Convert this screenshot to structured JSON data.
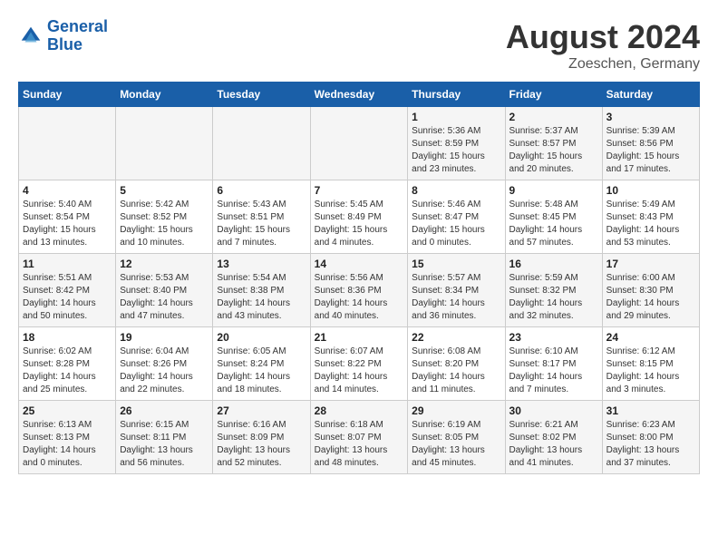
{
  "header": {
    "logo_line1": "General",
    "logo_line2": "Blue",
    "month": "August 2024",
    "location": "Zoeschen, Germany"
  },
  "weekdays": [
    "Sunday",
    "Monday",
    "Tuesday",
    "Wednesday",
    "Thursday",
    "Friday",
    "Saturday"
  ],
  "weeks": [
    [
      {
        "day": "",
        "info": ""
      },
      {
        "day": "",
        "info": ""
      },
      {
        "day": "",
        "info": ""
      },
      {
        "day": "",
        "info": ""
      },
      {
        "day": "1",
        "info": "Sunrise: 5:36 AM\nSunset: 8:59 PM\nDaylight: 15 hours\nand 23 minutes."
      },
      {
        "day": "2",
        "info": "Sunrise: 5:37 AM\nSunset: 8:57 PM\nDaylight: 15 hours\nand 20 minutes."
      },
      {
        "day": "3",
        "info": "Sunrise: 5:39 AM\nSunset: 8:56 PM\nDaylight: 15 hours\nand 17 minutes."
      }
    ],
    [
      {
        "day": "4",
        "info": "Sunrise: 5:40 AM\nSunset: 8:54 PM\nDaylight: 15 hours\nand 13 minutes."
      },
      {
        "day": "5",
        "info": "Sunrise: 5:42 AM\nSunset: 8:52 PM\nDaylight: 15 hours\nand 10 minutes."
      },
      {
        "day": "6",
        "info": "Sunrise: 5:43 AM\nSunset: 8:51 PM\nDaylight: 15 hours\nand 7 minutes."
      },
      {
        "day": "7",
        "info": "Sunrise: 5:45 AM\nSunset: 8:49 PM\nDaylight: 15 hours\nand 4 minutes."
      },
      {
        "day": "8",
        "info": "Sunrise: 5:46 AM\nSunset: 8:47 PM\nDaylight: 15 hours\nand 0 minutes."
      },
      {
        "day": "9",
        "info": "Sunrise: 5:48 AM\nSunset: 8:45 PM\nDaylight: 14 hours\nand 57 minutes."
      },
      {
        "day": "10",
        "info": "Sunrise: 5:49 AM\nSunset: 8:43 PM\nDaylight: 14 hours\nand 53 minutes."
      }
    ],
    [
      {
        "day": "11",
        "info": "Sunrise: 5:51 AM\nSunset: 8:42 PM\nDaylight: 14 hours\nand 50 minutes."
      },
      {
        "day": "12",
        "info": "Sunrise: 5:53 AM\nSunset: 8:40 PM\nDaylight: 14 hours\nand 47 minutes."
      },
      {
        "day": "13",
        "info": "Sunrise: 5:54 AM\nSunset: 8:38 PM\nDaylight: 14 hours\nand 43 minutes."
      },
      {
        "day": "14",
        "info": "Sunrise: 5:56 AM\nSunset: 8:36 PM\nDaylight: 14 hours\nand 40 minutes."
      },
      {
        "day": "15",
        "info": "Sunrise: 5:57 AM\nSunset: 8:34 PM\nDaylight: 14 hours\nand 36 minutes."
      },
      {
        "day": "16",
        "info": "Sunrise: 5:59 AM\nSunset: 8:32 PM\nDaylight: 14 hours\nand 32 minutes."
      },
      {
        "day": "17",
        "info": "Sunrise: 6:00 AM\nSunset: 8:30 PM\nDaylight: 14 hours\nand 29 minutes."
      }
    ],
    [
      {
        "day": "18",
        "info": "Sunrise: 6:02 AM\nSunset: 8:28 PM\nDaylight: 14 hours\nand 25 minutes."
      },
      {
        "day": "19",
        "info": "Sunrise: 6:04 AM\nSunset: 8:26 PM\nDaylight: 14 hours\nand 22 minutes."
      },
      {
        "day": "20",
        "info": "Sunrise: 6:05 AM\nSunset: 8:24 PM\nDaylight: 14 hours\nand 18 minutes."
      },
      {
        "day": "21",
        "info": "Sunrise: 6:07 AM\nSunset: 8:22 PM\nDaylight: 14 hours\nand 14 minutes."
      },
      {
        "day": "22",
        "info": "Sunrise: 6:08 AM\nSunset: 8:20 PM\nDaylight: 14 hours\nand 11 minutes."
      },
      {
        "day": "23",
        "info": "Sunrise: 6:10 AM\nSunset: 8:17 PM\nDaylight: 14 hours\nand 7 minutes."
      },
      {
        "day": "24",
        "info": "Sunrise: 6:12 AM\nSunset: 8:15 PM\nDaylight: 14 hours\nand 3 minutes."
      }
    ],
    [
      {
        "day": "25",
        "info": "Sunrise: 6:13 AM\nSunset: 8:13 PM\nDaylight: 14 hours\nand 0 minutes."
      },
      {
        "day": "26",
        "info": "Sunrise: 6:15 AM\nSunset: 8:11 PM\nDaylight: 13 hours\nand 56 minutes."
      },
      {
        "day": "27",
        "info": "Sunrise: 6:16 AM\nSunset: 8:09 PM\nDaylight: 13 hours\nand 52 minutes."
      },
      {
        "day": "28",
        "info": "Sunrise: 6:18 AM\nSunset: 8:07 PM\nDaylight: 13 hours\nand 48 minutes."
      },
      {
        "day": "29",
        "info": "Sunrise: 6:19 AM\nSunset: 8:05 PM\nDaylight: 13 hours\nand 45 minutes."
      },
      {
        "day": "30",
        "info": "Sunrise: 6:21 AM\nSunset: 8:02 PM\nDaylight: 13 hours\nand 41 minutes."
      },
      {
        "day": "31",
        "info": "Sunrise: 6:23 AM\nSunset: 8:00 PM\nDaylight: 13 hours\nand 37 minutes."
      }
    ]
  ]
}
